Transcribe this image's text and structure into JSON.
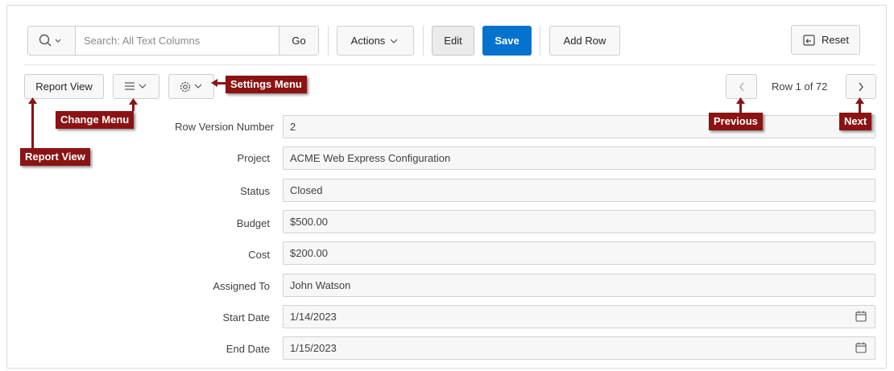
{
  "toolbar": {
    "search_placeholder": "Search: All Text Columns",
    "go_label": "Go",
    "actions_label": "Actions",
    "edit_label": "Edit",
    "save_label": "Save",
    "add_row_label": "Add Row",
    "reset_label": "Reset"
  },
  "subtoolbar": {
    "report_view_label": "Report View",
    "row_status": "Row 1 of 72"
  },
  "callouts": {
    "settings_menu": "Settings Menu",
    "change_menu": "Change Menu",
    "report_view": "Report View",
    "previous": "Previous",
    "next": "Next"
  },
  "form": {
    "fields": [
      {
        "label": "Row Version Number",
        "value": "2"
      },
      {
        "label": "Project",
        "value": "ACME Web Express Configuration"
      },
      {
        "label": "Status",
        "value": "Closed"
      },
      {
        "label": "Budget",
        "value": "$500.00"
      },
      {
        "label": "Cost",
        "value": "$200.00"
      },
      {
        "label": "Assigned To",
        "value": "John Watson"
      },
      {
        "label": "Start Date",
        "value": "1/14/2023"
      },
      {
        "label": "End Date",
        "value": "1/15/2023"
      }
    ]
  },
  "colors": {
    "primary": "#0572ce",
    "callout": "#8b1313"
  }
}
